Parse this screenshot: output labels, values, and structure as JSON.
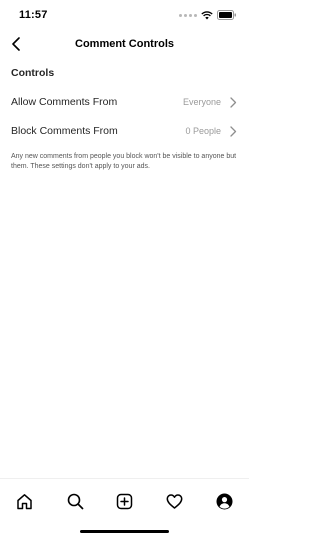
{
  "status_bar": {
    "time": "11:57",
    "icons": [
      "signal-dots-icon",
      "wifi-icon",
      "battery-icon"
    ]
  },
  "nav": {
    "title": "Comment Controls",
    "back_icon": "chevron-left-icon"
  },
  "controls": {
    "section_title": "Controls",
    "rows": [
      {
        "label": "Allow Comments From",
        "value": "Everyone",
        "icon": "chevron-right-icon"
      },
      {
        "label": "Block Comments From",
        "value": "0 People",
        "icon": "chevron-right-icon"
      }
    ],
    "note": "Any new comments from people you block won't be visible to anyone but them. These settings don't apply to your ads."
  },
  "tab_bar": {
    "items": [
      "home-icon",
      "search-icon",
      "add-post-icon",
      "heart-icon",
      "profile-icon"
    ]
  },
  "colors": {
    "text": "#262626",
    "secondary_text": "#9a9a9a",
    "background": "#ffffff"
  }
}
